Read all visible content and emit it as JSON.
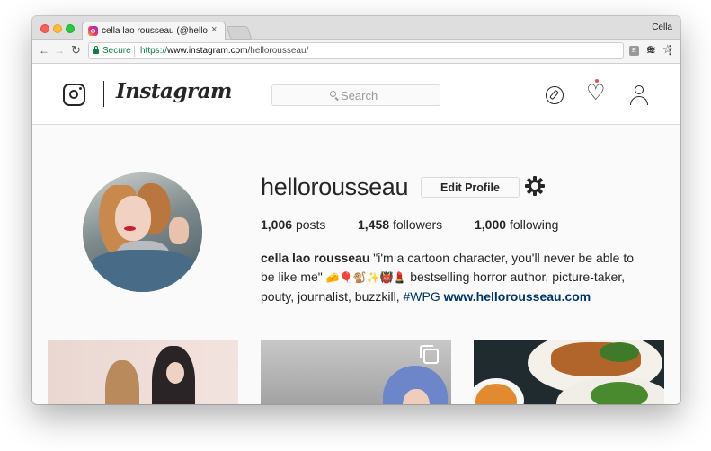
{
  "browser": {
    "tab_title": "cella lao rousseau (@hellorousseau)",
    "tab_close": "×",
    "profile_name": "Cella",
    "secure_label": "Secure",
    "url_scheme": "https://",
    "url_host": "www.instagram.com",
    "url_path": "/hellorousseau/",
    "nav": {
      "back": "←",
      "forward": "→",
      "reload": "↻"
    },
    "zoom_glyph": "⊕",
    "star_glyph": "☆",
    "ext1_label": "E",
    "ext2_glyph": "≋",
    "menu_glyph": "⋮"
  },
  "header": {
    "wordmark": "Instagram",
    "search_placeholder": "Search",
    "heart_glyph": "♡",
    "icons": [
      "instagram-glyph-icon",
      "compass-icon",
      "heart-icon",
      "person-icon"
    ]
  },
  "profile": {
    "username": "hellorousseau",
    "edit_button": "Edit Profile",
    "posts_count": "1,006",
    "posts_label": "posts",
    "followers_count": "1,458",
    "followers_label": "followers",
    "following_count": "1,000",
    "following_label": "following",
    "full_name": "cella lao rousseau",
    "bio_text_1": "\"i'm a cartoon character, you'll never be able to be like me\"",
    "bio_emojis": "🧀🎈🐒✨👹💄",
    "bio_text_2": "bestselling horror author, picture-taker, pouty, journalist, buzzkill,",
    "hashtag": "#WPG",
    "website": "www.hellorousseau.com"
  },
  "posts": [
    {
      "name": "post-1",
      "has_carousel": false
    },
    {
      "name": "post-2",
      "has_carousel": true
    },
    {
      "name": "post-3",
      "has_carousel": false
    }
  ],
  "colors": {
    "link": "#003569",
    "notification": "#ed4956",
    "secure_green": "#0b8043",
    "text": "#262626"
  }
}
